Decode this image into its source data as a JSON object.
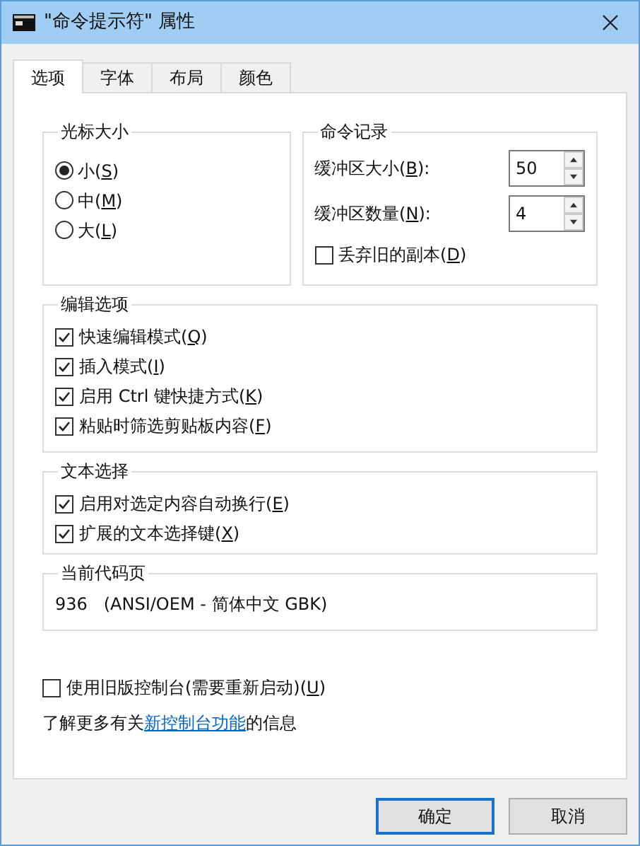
{
  "window": {
    "title": "\"命令提示符\" 属性"
  },
  "tabs": [
    {
      "label": "选项",
      "selected": true
    },
    {
      "label": "字体",
      "selected": false
    },
    {
      "label": "布局",
      "selected": false
    },
    {
      "label": "颜色",
      "selected": false
    }
  ],
  "cursor_size": {
    "title": "光标大小",
    "options": [
      {
        "text": "小(",
        "accel": "S",
        "tail": ")",
        "selected": true
      },
      {
        "text": "中(",
        "accel": "M",
        "tail": ")",
        "selected": false
      },
      {
        "text": "大(",
        "accel": "L",
        "tail": ")",
        "selected": false
      }
    ]
  },
  "command_history": {
    "title": "命令记录",
    "spinners": [
      {
        "text": "缓冲区大小(",
        "accel": "B",
        "tail": "):",
        "value": "50"
      },
      {
        "text": "缓冲区数量(",
        "accel": "N",
        "tail": "):",
        "value": "4"
      }
    ],
    "discard": {
      "text": "丢弃旧的副本(",
      "accel": "D",
      "tail": ")",
      "checked": false
    }
  },
  "edit_options": {
    "title": "编辑选项",
    "items": [
      {
        "text": "快速编辑模式(",
        "accel": "Q",
        "tail": ")",
        "checked": true
      },
      {
        "text": "插入模式(",
        "accel": "I",
        "tail": ")",
        "checked": true
      },
      {
        "text": "启用 Ctrl 键快捷方式(",
        "accel": "K",
        "tail": ")",
        "checked": true
      },
      {
        "text": "粘贴时筛选剪贴板内容(",
        "accel": "F",
        "tail": ")",
        "checked": true
      }
    ]
  },
  "text_selection": {
    "title": "文本选择",
    "items": [
      {
        "text": "启用对选定内容自动换行(",
        "accel": "E",
        "tail": ")",
        "checked": true
      },
      {
        "text": "扩展的文本选择键(",
        "accel": "X",
        "tail": ")",
        "checked": true
      }
    ]
  },
  "code_page": {
    "title": "当前代码页",
    "value": "936   (ANSI/OEM - 简体中文 GBK)"
  },
  "legacy_console": {
    "text": "使用旧版控制台(需要重新启动)(",
    "accel": "U",
    "tail": ")",
    "checked": false
  },
  "info": {
    "before": "了解更多有关",
    "link": "新控制台功能",
    "after": "的信息"
  },
  "buttons": [
    {
      "label": "确定",
      "default": true
    },
    {
      "label": "取消",
      "default": false
    }
  ]
}
